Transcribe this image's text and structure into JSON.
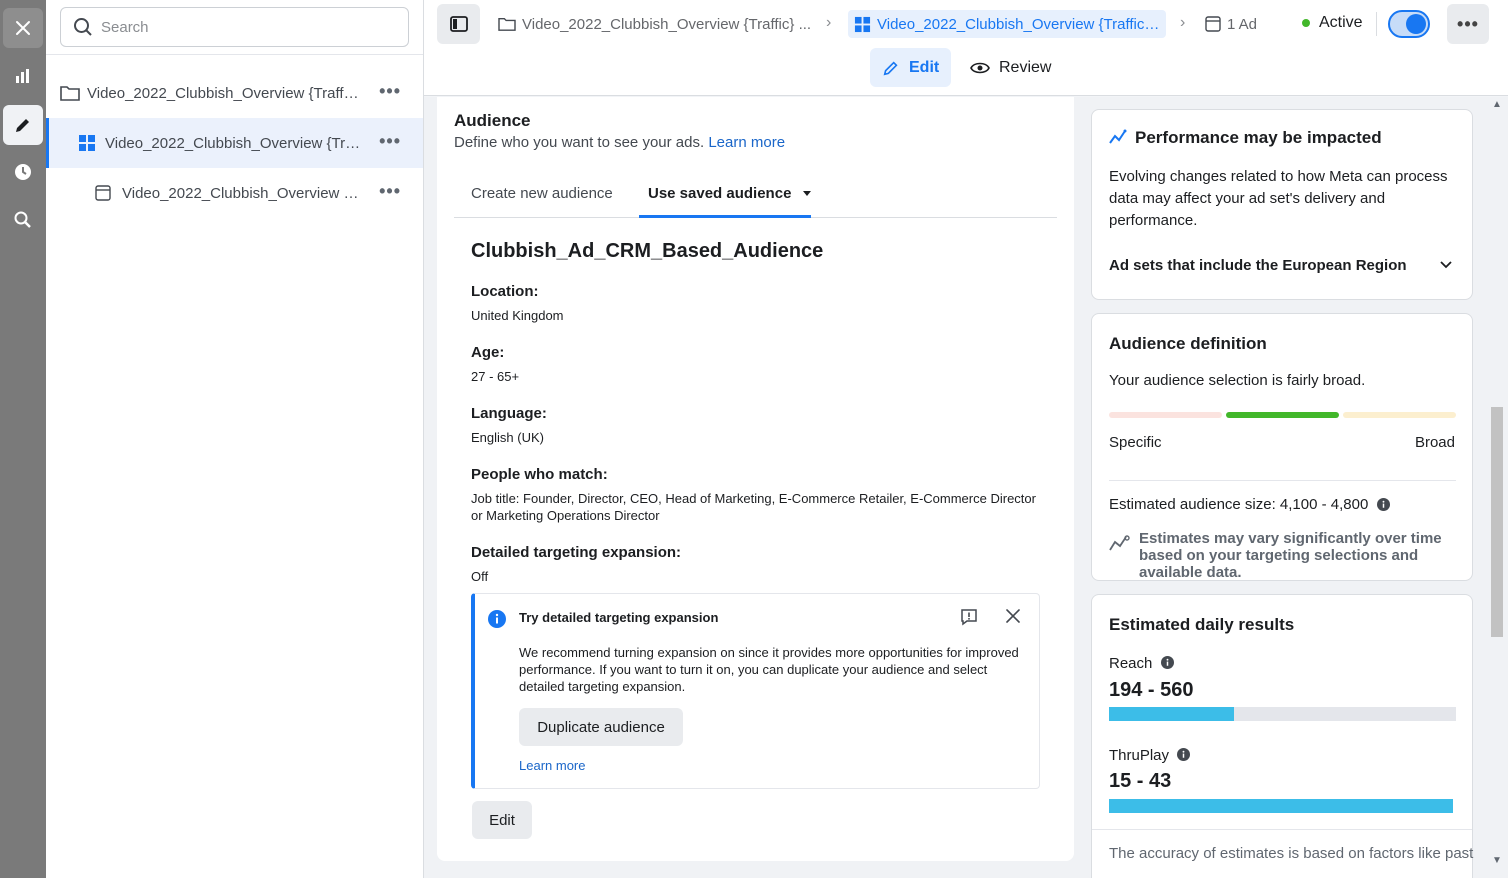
{
  "search": {
    "placeholder": "Search"
  },
  "tree": {
    "items": [
      {
        "label": "Video_2022_Clubbish_Overview {Traffi...",
        "type": "campaign"
      },
      {
        "label": "Video_2022_Clubbish_Overview {Tra...",
        "type": "ad-set"
      },
      {
        "label": "Video_2022_Clubbish_Overview {...",
        "type": "ad"
      }
    ],
    "more": "•••"
  },
  "breadcrumb": {
    "campaign": "Video_2022_Clubbish_Overview {Traffic} ...",
    "adset": "Video_2022_Clubbish_Overview {Traffic} ...",
    "ad": "1 Ad"
  },
  "status": {
    "label": "Active"
  },
  "toolbar": {
    "more": "•••"
  },
  "modes": {
    "edit": "Edit",
    "review": "Review"
  },
  "audience": {
    "title": "Audience",
    "description": "Define who you want to see your ads.",
    "learn_more": "Learn more",
    "tabs": {
      "create": "Create new audience",
      "saved": "Use saved audience"
    },
    "name": "Clubbish_Ad_CRM_Based_Audience",
    "location_label": "Location:",
    "location_value": "United Kingdom",
    "age_label": "Age:",
    "age_value": "27 - 65+",
    "language_label": "Language:",
    "language_value": "English (UK)",
    "people_label": "People who match:",
    "people_value": "Job title: Founder, Director, CEO, Head of Marketing, E-Commerce Retailer, E-Commerce Director or Marketing Operations Director",
    "expansion_label": "Detailed targeting expansion:",
    "expansion_value": "Off",
    "notice": {
      "title": "Try detailed targeting expansion",
      "body": "We recommend turning expansion on since it provides more opportunities for improved performance. If you want to turn it on, you can duplicate your audience and select detailed targeting expansion.",
      "button": "Duplicate audience",
      "link": "Learn more"
    },
    "edit_button": "Edit"
  },
  "performance": {
    "title": "Performance may be impacted",
    "body": "Evolving changes related to how Meta can process data may affect your ad set's delivery and performance.",
    "expander": "Ad sets that include the European Region"
  },
  "definition": {
    "title": "Audience definition",
    "summary": "Your audience selection is fairly broad.",
    "specific": "Specific",
    "broad": "Broad",
    "size": "Estimated audience size: 4,100 - 4,800",
    "note": "Estimates may vary significantly over time based on your targeting selections and available data."
  },
  "daily": {
    "title": "Estimated daily results",
    "reach_label": "Reach",
    "reach_value": "194 - 560",
    "reach_fill": 0.36,
    "thruplay_label": "ThruPlay",
    "thruplay_value": "15 - 43",
    "thruplay_fill": 0.99,
    "footer": "The accuracy of estimates is based on factors like past"
  },
  "colors": {
    "accent": "#1877f2",
    "active": "#42b72a",
    "meter": "#42b72a",
    "bar": "#3cbde8"
  }
}
